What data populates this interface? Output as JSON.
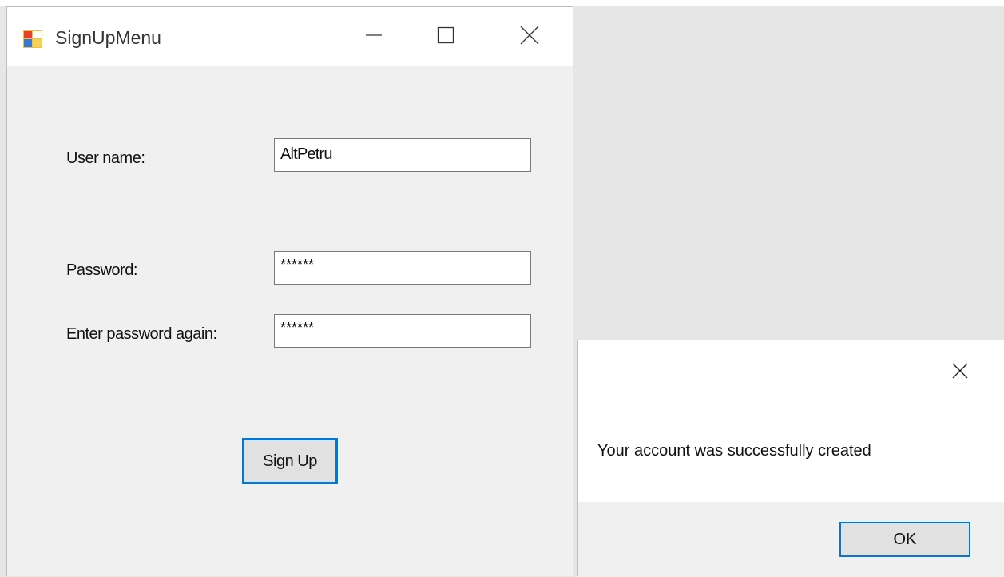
{
  "window": {
    "title": "SignUpMenu",
    "icon": "form-app-icon",
    "caption_icons": [
      "minimize-icon",
      "maximize-icon",
      "close-icon"
    ]
  },
  "form": {
    "username_label": "User name:",
    "username_value": "AltPetru",
    "password_label": "Password:",
    "password_value": "******",
    "confirm_label": "Enter password again:",
    "confirm_value": "******",
    "signup_label": "Sign Up"
  },
  "dialog": {
    "message": "Your account was successfully created",
    "ok_label": "OK",
    "close_icon": "close-icon"
  },
  "colors": {
    "accent": "#0078d7",
    "window_bg": "#f0f0f0",
    "titlebar_bg": "#ffffff"
  }
}
